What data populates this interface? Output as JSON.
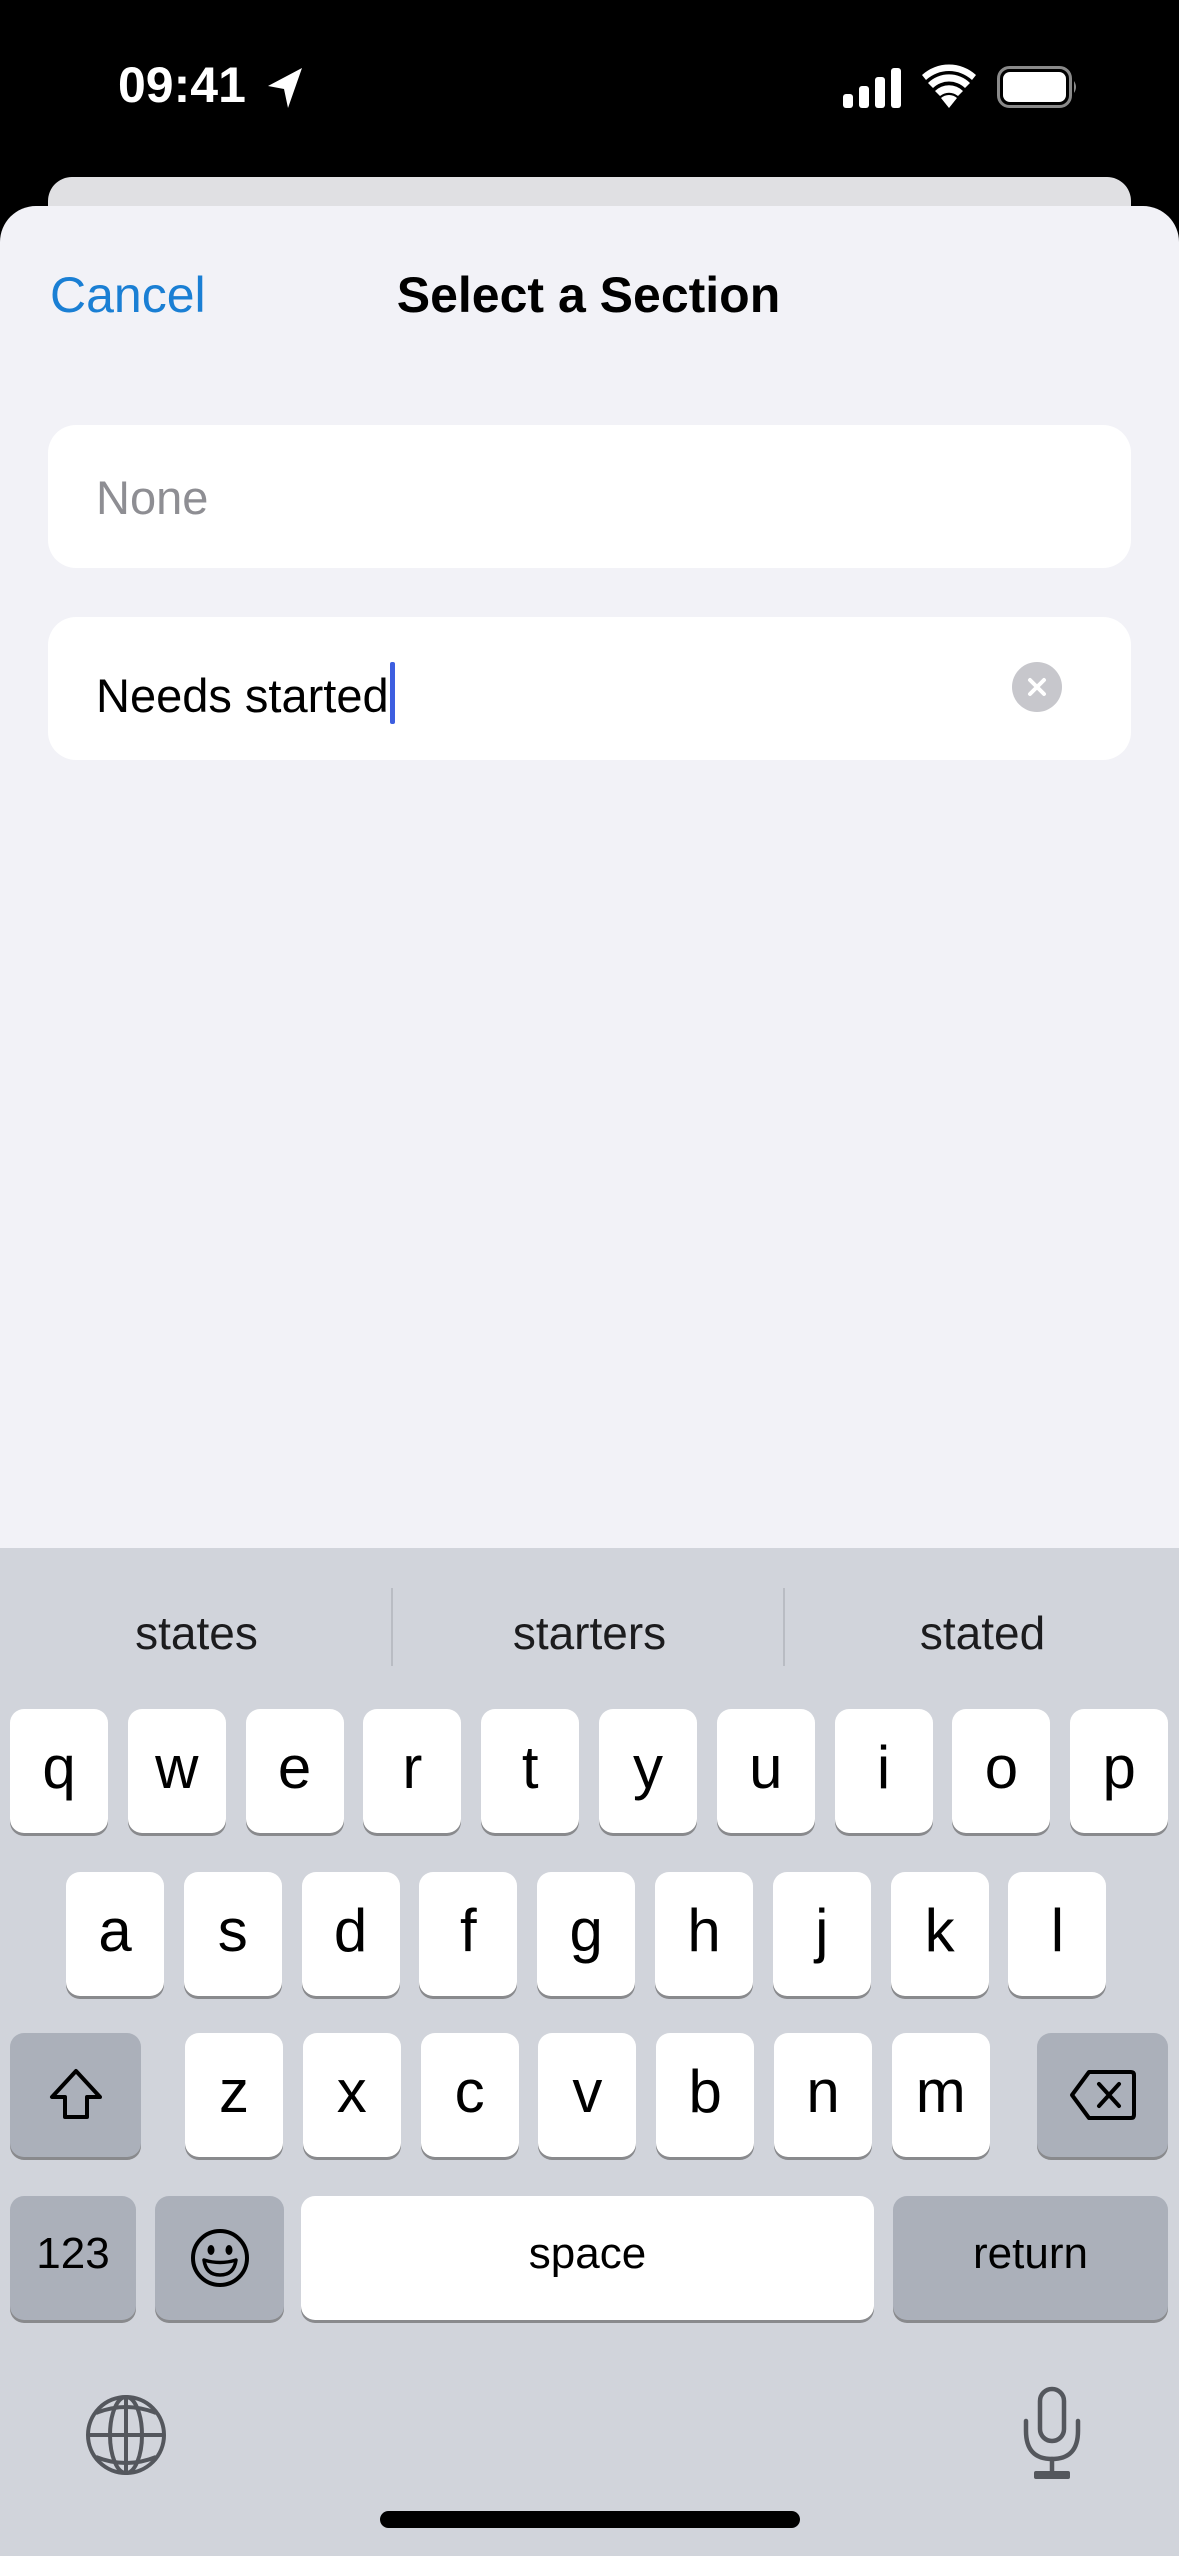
{
  "status_bar": {
    "time": "09:41",
    "icons": [
      "location-arrow-icon",
      "cellular-signal-icon",
      "wifi-icon",
      "battery-icon"
    ]
  },
  "sheet": {
    "cancel_label": "Cancel",
    "title": "Select a Section",
    "fields": [
      {
        "placeholder": "None",
        "value": ""
      },
      {
        "placeholder": "",
        "value": "Needs started",
        "focused": true,
        "clear_icon": "clear-circle-icon"
      }
    ]
  },
  "colors": {
    "accent": "#1a7fd4",
    "sheet_bg": "#f2f2f7",
    "keyboard_bg": "#d1d4db",
    "caret": "#3d5ee0"
  },
  "keyboard": {
    "suggestions": [
      "states",
      "starters",
      "stated"
    ],
    "row1": [
      "q",
      "w",
      "e",
      "r",
      "t",
      "y",
      "u",
      "i",
      "o",
      "p"
    ],
    "row2": [
      "a",
      "s",
      "d",
      "f",
      "g",
      "h",
      "j",
      "k",
      "l"
    ],
    "row3": [
      "z",
      "x",
      "c",
      "v",
      "b",
      "n",
      "m"
    ],
    "shift_icon": "shift-icon",
    "delete_icon": "delete-backward-icon",
    "numbers_label": "123",
    "emoji_icon": "emoji-smiley-icon",
    "space_label": "space",
    "return_label": "return",
    "globe_icon": "globe-icon",
    "mic_icon": "microphone-icon"
  }
}
